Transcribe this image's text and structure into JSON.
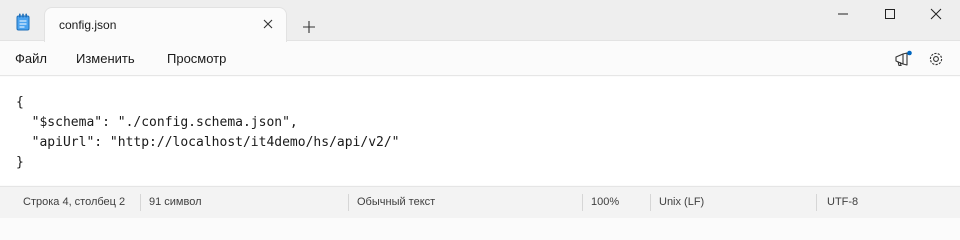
{
  "tab": {
    "title": "config.json"
  },
  "menu": {
    "file": "Файл",
    "edit": "Изменить",
    "view": "Просмотр"
  },
  "editor": {
    "lines": [
      "{",
      "  \"$schema\": \"./config.schema.json\",",
      "  \"apiUrl\": \"http://localhost/it4demo/hs/api/v2/\"",
      "}"
    ]
  },
  "status": {
    "position": "Строка 4, столбец 2",
    "chars": "91 символ",
    "format": "Обычный текст",
    "zoom": "100%",
    "eol": "Unix (LF)",
    "encoding": "UTF-8"
  },
  "icons": {
    "app": "notepad-icon",
    "tab_close": "close-icon",
    "new_tab": "plus-icon",
    "minimize": "minimize-icon",
    "maximize": "maximize-icon",
    "close": "close-icon",
    "whats_new": "megaphone-icon",
    "settings": "gear-icon"
  },
  "colors": {
    "accent": "#0067c0",
    "titlebar": "#eeeeee",
    "editor": "#ffffff"
  }
}
